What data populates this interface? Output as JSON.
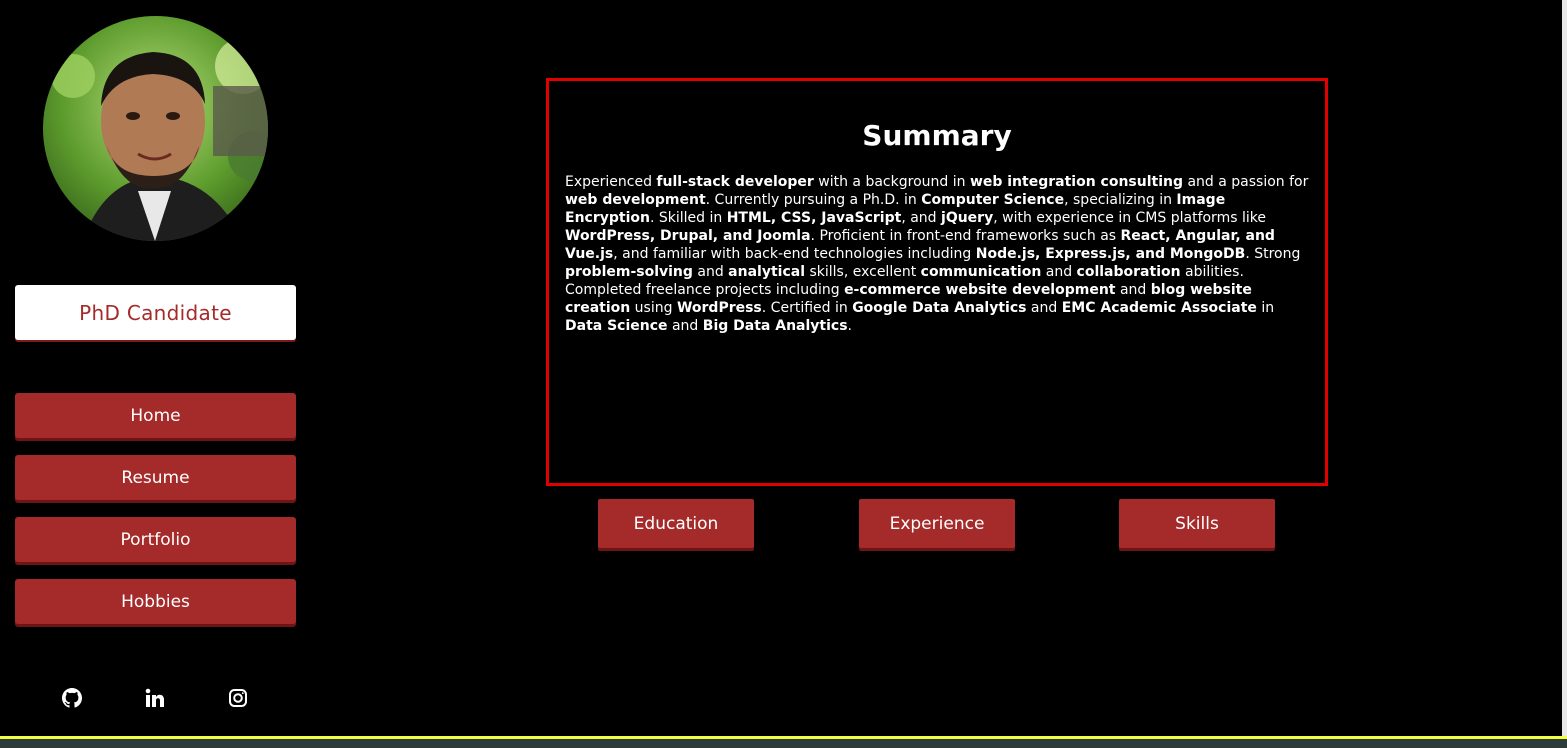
{
  "sidebar": {
    "avatar_alt": "profile photo",
    "role": "PhD Candidate",
    "nav": [
      {
        "label": "Home"
      },
      {
        "label": "Resume"
      },
      {
        "label": "Portfolio"
      },
      {
        "label": "Hobbies"
      }
    ],
    "social": [
      {
        "icon": "github-icon"
      },
      {
        "icon": "linkedin-icon"
      },
      {
        "icon": "instagram-icon"
      }
    ]
  },
  "summary": {
    "title": "Summary",
    "segments": [
      {
        "t": "Experienced "
      },
      {
        "t": "full-stack developer",
        "b": true
      },
      {
        "t": " with a background in "
      },
      {
        "t": "web integration consulting",
        "b": true
      },
      {
        "t": " and a passion for "
      },
      {
        "t": "web development",
        "b": true
      },
      {
        "t": ". Currently pursuing a Ph.D. in "
      },
      {
        "t": "Computer Science",
        "b": true
      },
      {
        "t": ", specializing in "
      },
      {
        "t": "Image Encryption",
        "b": true
      },
      {
        "t": ". Skilled in "
      },
      {
        "t": "HTML, CSS, JavaScript",
        "b": true
      },
      {
        "t": ", and "
      },
      {
        "t": "jQuery",
        "b": true
      },
      {
        "t": ", with experience in CMS platforms like "
      },
      {
        "t": "WordPress, Drupal, and Joomla",
        "b": true
      },
      {
        "t": ". Proficient in front-end frameworks such as "
      },
      {
        "t": "React, Angular, and Vue.js",
        "b": true
      },
      {
        "t": ", and familiar with back-end technologies including "
      },
      {
        "t": "Node.js, Express.js, and MongoDB",
        "b": true
      },
      {
        "t": ". Strong "
      },
      {
        "t": "problem-solving",
        "b": true
      },
      {
        "t": " and "
      },
      {
        "t": "analytical",
        "b": true
      },
      {
        "t": " skills, excellent "
      },
      {
        "t": "communication",
        "b": true
      },
      {
        "t": " and "
      },
      {
        "t": "collaboration",
        "b": true
      },
      {
        "t": " abilities. Completed freelance projects including "
      },
      {
        "t": "e-commerce website development",
        "b": true
      },
      {
        "t": " and "
      },
      {
        "t": "blog website creation",
        "b": true
      },
      {
        "t": " using "
      },
      {
        "t": "WordPress",
        "b": true
      },
      {
        "t": ". Certified in "
      },
      {
        "t": "Google Data Analytics",
        "b": true
      },
      {
        "t": " and "
      },
      {
        "t": "EMC Academic Associate",
        "b": true
      },
      {
        "t": " in "
      },
      {
        "t": "Data Science",
        "b": true
      },
      {
        "t": " and "
      },
      {
        "t": "Big Data Analytics",
        "b": true
      },
      {
        "t": "."
      }
    ]
  },
  "tabs": [
    {
      "label": "Education"
    },
    {
      "label": "Experience"
    },
    {
      "label": "Skills"
    }
  ],
  "colors": {
    "accent": "#a52a2a",
    "border": "#e00000",
    "background": "#000000"
  }
}
